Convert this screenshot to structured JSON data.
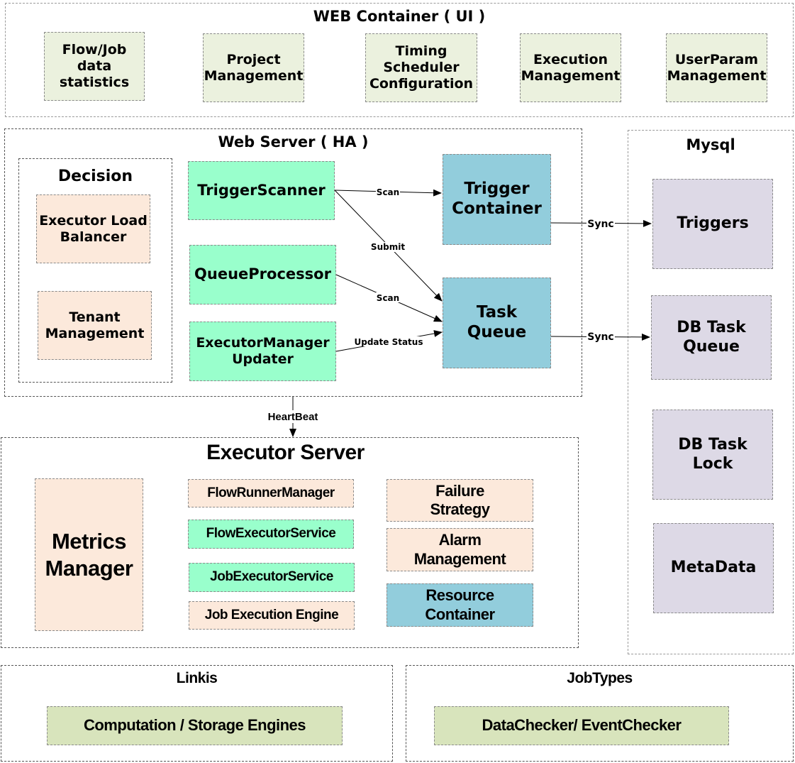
{
  "web_container": {
    "title": "WEB Container ( UI )",
    "items": [
      "Flow/Job\ndata statistics",
      "Project\nManagement",
      "Timing\nScheduler\nConfiguration",
      "Execution\nManagement",
      "UserParam\nManagement"
    ]
  },
  "web_server": {
    "title": "Web Server ( HA )",
    "decision": {
      "title": "Decision",
      "items": [
        "Executor Load\nBalancer",
        "Tenant\nManagement"
      ]
    },
    "components": [
      "TriggerScanner",
      "QueueProcessor",
      "ExecutorManager\nUpdater"
    ],
    "containers": [
      "Trigger\nContainer",
      "Task\nQueue"
    ],
    "edges": {
      "scan1": "Scan",
      "submit": "Submit",
      "scan2": "Scan",
      "update_status": "Update Status",
      "sync1": "Sync",
      "sync2": "Sync",
      "heartbeat": "HeartBeat"
    }
  },
  "mysql": {
    "title": "Mysql",
    "items": [
      "Triggers",
      "DB Task\nQueue",
      "DB Task\nLock",
      "MetaData"
    ]
  },
  "executor_server": {
    "title": "Executor Server",
    "metrics": "Metrics\nManager",
    "middle": [
      "FlowRunnerManager",
      "FlowExecutorService",
      "JobExecutorService",
      "Job Execution Engine"
    ],
    "right": [
      "Failure\nStrategy",
      "Alarm\nManagement",
      "Resource\nContainer"
    ]
  },
  "linkis": {
    "title": "Linkis",
    "item": "Computation / Storage Engines"
  },
  "jobtypes": {
    "title": "JobTypes",
    "item": "DataChecker/ EventChecker"
  },
  "colors": {
    "ui_box": "#ebf1de",
    "peach": "#fce9db",
    "mint": "#99ffcc",
    "blue": "#92cddc",
    "lavender": "#ddd9e6",
    "olive": "#d8e4bc"
  }
}
